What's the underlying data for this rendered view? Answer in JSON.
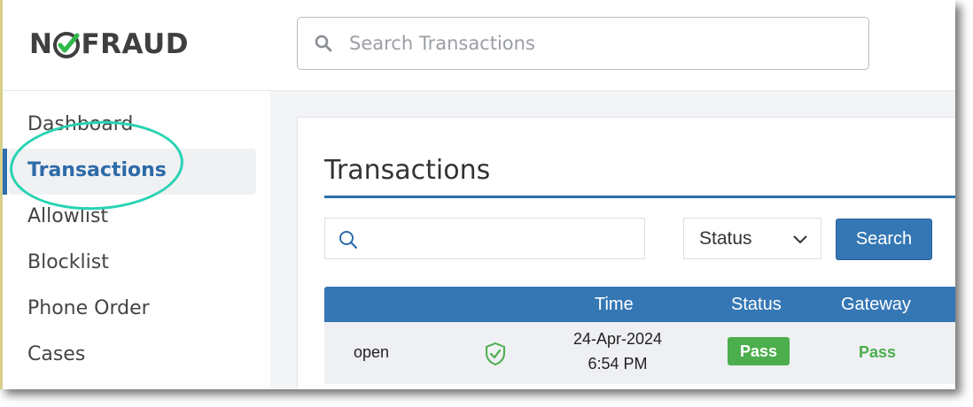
{
  "brand": {
    "logo_left": "N",
    "logo_right": "FRAUD",
    "accent": "#2fb84a"
  },
  "search": {
    "placeholder": "Search Transactions",
    "icon": "search-icon"
  },
  "sidebar": {
    "items": [
      {
        "label": "Dashboard",
        "active": false
      },
      {
        "label": "Transactions",
        "active": true
      },
      {
        "label": "Allowlist",
        "active": false
      },
      {
        "label": "Blocklist",
        "active": false
      },
      {
        "label": "Phone Order",
        "active": false
      },
      {
        "label": "Cases",
        "active": false
      }
    ],
    "active_color": "#2d6aa8",
    "highlight_color": "#27d3b3"
  },
  "main": {
    "title": "Transactions",
    "filter": {
      "icon": "search-icon",
      "value": ""
    },
    "status_select": {
      "selected": "Status"
    },
    "search_button": "Search",
    "table": {
      "columns": [
        "",
        "",
        "Time",
        "Status",
        "Gateway"
      ],
      "rows": [
        {
          "col1": "open",
          "icon": "shield-check-icon",
          "time_date": "24-Apr-2024",
          "time_clock": "6:54 PM",
          "status": "Pass",
          "gateway": "Pass"
        }
      ],
      "header_color": "#3577b5",
      "pass_color": "#4cae4c"
    }
  }
}
